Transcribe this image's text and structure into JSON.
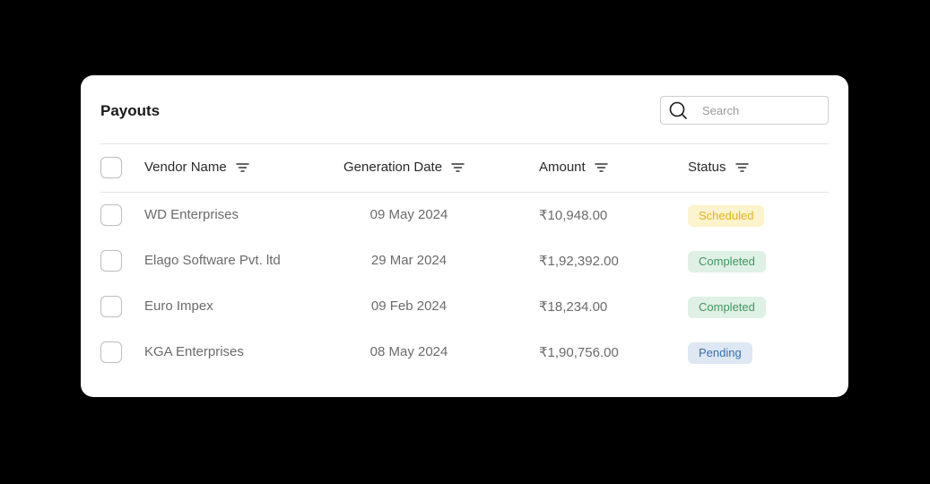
{
  "header": {
    "title": "Payouts",
    "search_placeholder": "Search",
    "search_value": ""
  },
  "columns": {
    "vendor": "Vendor Name",
    "date": "Generation Date",
    "amount": "Amount",
    "status": "Status"
  },
  "rows": [
    {
      "vendor": "WD Enterprises",
      "date": "09 May 2024",
      "amount": "₹10,948.00",
      "status": "Scheduled",
      "status_kind": "scheduled"
    },
    {
      "vendor": "Elago Software Pvt. ltd",
      "date": "29 Mar 2024",
      "amount": "₹1,92,392.00",
      "status": "Completed",
      "status_kind": "completed"
    },
    {
      "vendor": "Euro Impex",
      "date": "09 Feb 2024",
      "amount": "₹18,234.00",
      "status": "Completed",
      "status_kind": "completed"
    },
    {
      "vendor": "KGA Enterprises",
      "date": "08 May 2024",
      "amount": "₹1,90,756.00",
      "status": "Pending",
      "status_kind": "pending"
    }
  ],
  "colors": {
    "scheduled_bg": "#fdf3cc",
    "scheduled_fg": "#e3b21d",
    "completed_bg": "#dff0e5",
    "completed_fg": "#3f9a62",
    "pending_bg": "#dde8f4",
    "pending_fg": "#3a6fa8"
  },
  "icons": {
    "search": "search-icon",
    "filter": "filter-icon"
  }
}
